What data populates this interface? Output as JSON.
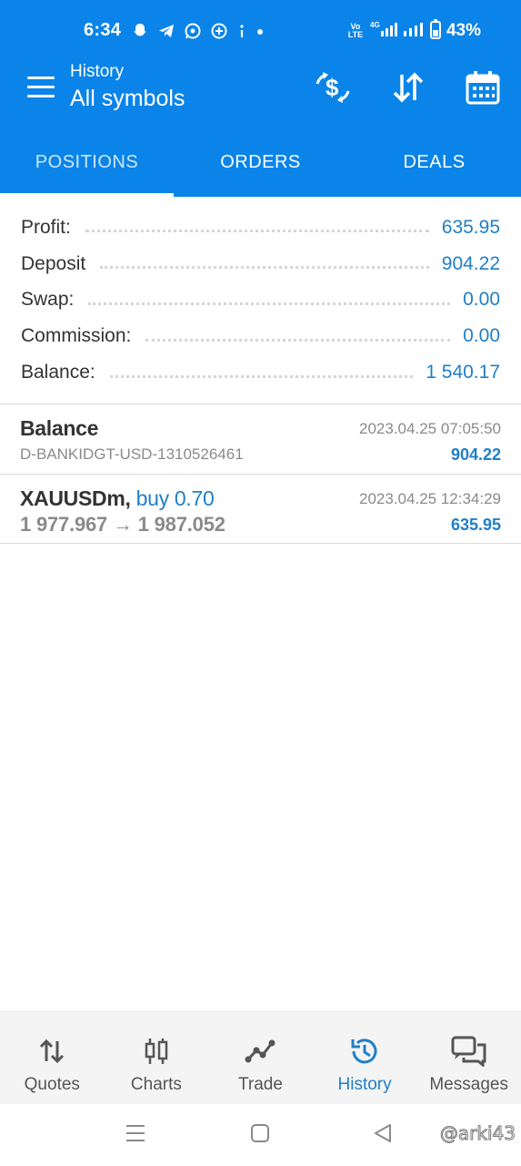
{
  "status_bar": {
    "time": "6:34",
    "network_label": "Vo LTE",
    "network_type": "4G",
    "battery": "43%",
    "icons": [
      "snapchat-icon",
      "telegram-icon",
      "whatsapp-icon",
      "add-circle-icon",
      "info-icon",
      "dot-icon"
    ]
  },
  "app_bar": {
    "subtitle": "History",
    "title": "All symbols",
    "actions": [
      "currency-exchange-icon",
      "sort-icon",
      "calendar-icon"
    ]
  },
  "tabs": [
    {
      "label": "POSITIONS",
      "active": true
    },
    {
      "label": "ORDERS",
      "active": false
    },
    {
      "label": "DEALS",
      "active": false
    }
  ],
  "summary": [
    {
      "label": "Profit:",
      "value": "635.95"
    },
    {
      "label": "Deposit",
      "value": "904.22"
    },
    {
      "label": "Swap:",
      "value": "0.00"
    },
    {
      "label": "Commission:",
      "value": "0.00"
    },
    {
      "label": "Balance:",
      "value": "1 540.17"
    }
  ],
  "deals": [
    {
      "title": "Balance",
      "subtitle": "D-BANKIDGT-USD-1310526461",
      "time": "2023.04.25 07:05:50",
      "amount": "904.22"
    },
    {
      "symbol": "XAUUSDm,",
      "direction": "buy 0.70",
      "prices": "1 977.967 → 1 987.052",
      "time": "2023.04.25 12:34:29",
      "amount": "635.95"
    }
  ],
  "bottom_nav": [
    {
      "label": "Quotes",
      "icon": "quotes-icon",
      "active": false
    },
    {
      "label": "Charts",
      "icon": "charts-icon",
      "active": false
    },
    {
      "label": "Trade",
      "icon": "trade-icon",
      "active": false
    },
    {
      "label": "History",
      "icon": "history-icon",
      "active": true
    },
    {
      "label": "Messages",
      "icon": "messages-icon",
      "active": false
    }
  ],
  "watermark": "@arki43",
  "colors": {
    "primary": "#0a84e8",
    "accent_value": "#1f7fc9",
    "text": "#333333",
    "muted": "#8a8a8a"
  }
}
